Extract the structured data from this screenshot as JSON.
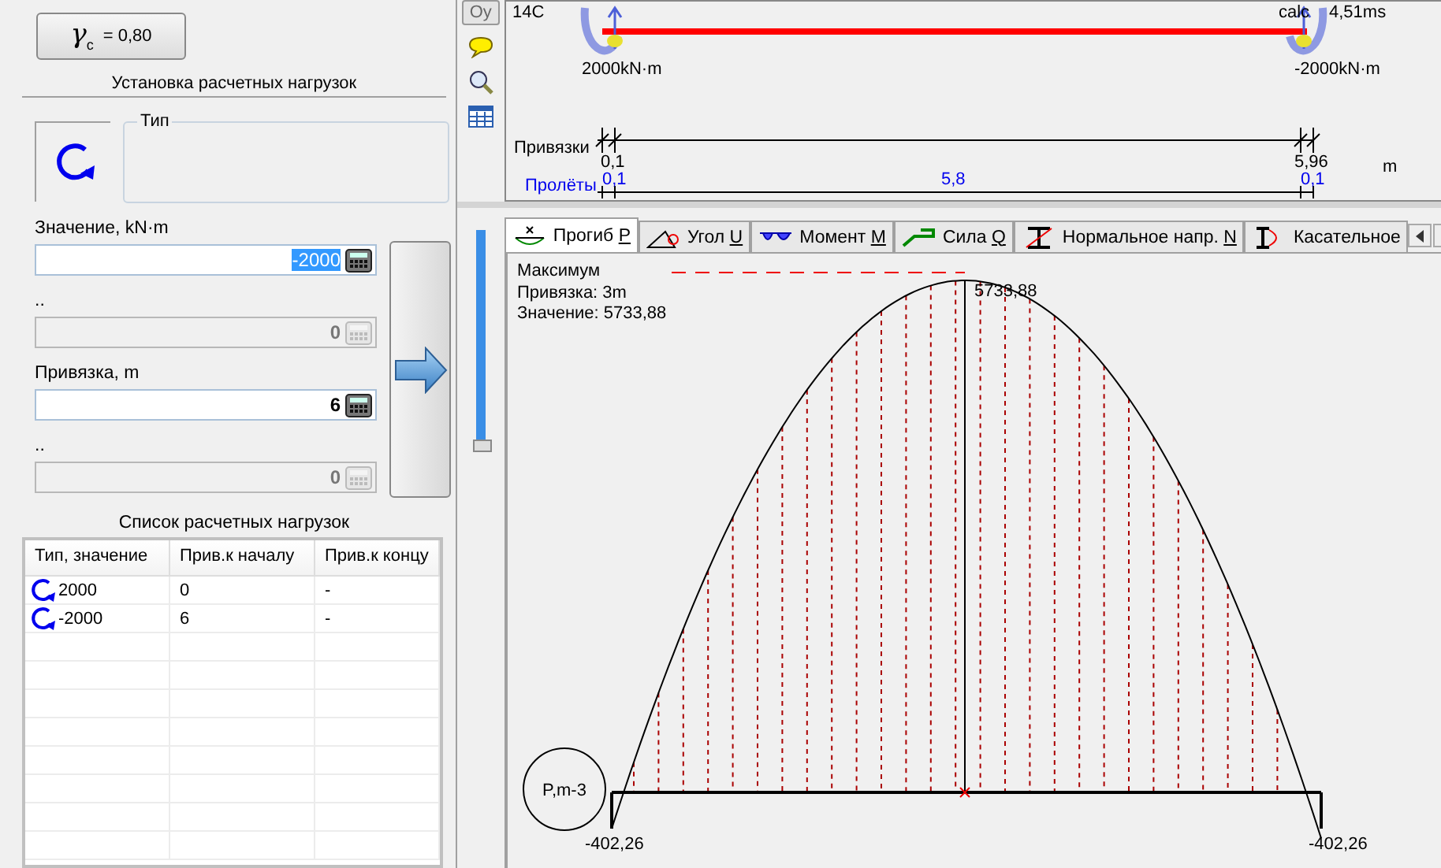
{
  "coefficient_button": {
    "symbol": "γ",
    "subscript": "c",
    "value": "= 0,80"
  },
  "loads_section": {
    "title": "Установка расчетных нагрузок",
    "type_label": "Тип",
    "fields": [
      {
        "label": "Значение, kN·m",
        "value": "-2000",
        "highlighted": true,
        "disabled": false
      },
      {
        "label": "..",
        "value": "0",
        "highlighted": false,
        "disabled": true
      },
      {
        "label": "Привязка, m",
        "value": "6",
        "highlighted": false,
        "disabled": false
      },
      {
        "label": "..",
        "value": "0",
        "highlighted": false,
        "disabled": true
      }
    ]
  },
  "load_list": {
    "title": "Список расчетных нагрузок",
    "columns": [
      "Тип, значение",
      "Прив.к началу",
      "Прив.к концу"
    ],
    "rows": [
      {
        "value": "2000",
        "start": "0",
        "end": "-"
      },
      {
        "value": "-2000",
        "start": "6",
        "end": "-"
      }
    ]
  },
  "toolbar": {
    "axis_button": "Oy"
  },
  "beam": {
    "section": "14C",
    "calc": "calc",
    "time": "4,51ms",
    "left_load": "2000kN·m",
    "right_load": "-2000kN·m",
    "bindings_label": "Привязки",
    "bindings": [
      "0,1",
      "5,96"
    ],
    "unit": "m",
    "spans_label": "Пролёты",
    "spans": [
      "0,1",
      "5,8",
      "0,1"
    ]
  },
  "slider": {
    "level": 0.34
  },
  "tabs": [
    {
      "label": "Прогиб ",
      "key": "P",
      "selected": true
    },
    {
      "label": "Угол ",
      "key": "U",
      "selected": false
    },
    {
      "label": "Момент ",
      "key": "M",
      "selected": false
    },
    {
      "label": "Сила ",
      "key": "Q",
      "selected": false
    },
    {
      "label": "Нормальное напр. ",
      "key": "N",
      "selected": false
    },
    {
      "label": "Касательное",
      "selected": false
    }
  ],
  "plot": {
    "max_title": "Максимум",
    "binding": "Привязка: 3m",
    "value": "Значение: 5733,88",
    "peak_label": "5733,88",
    "left_label": "-402,26",
    "right_label": "-402,26",
    "badge": "P,m-3"
  }
}
